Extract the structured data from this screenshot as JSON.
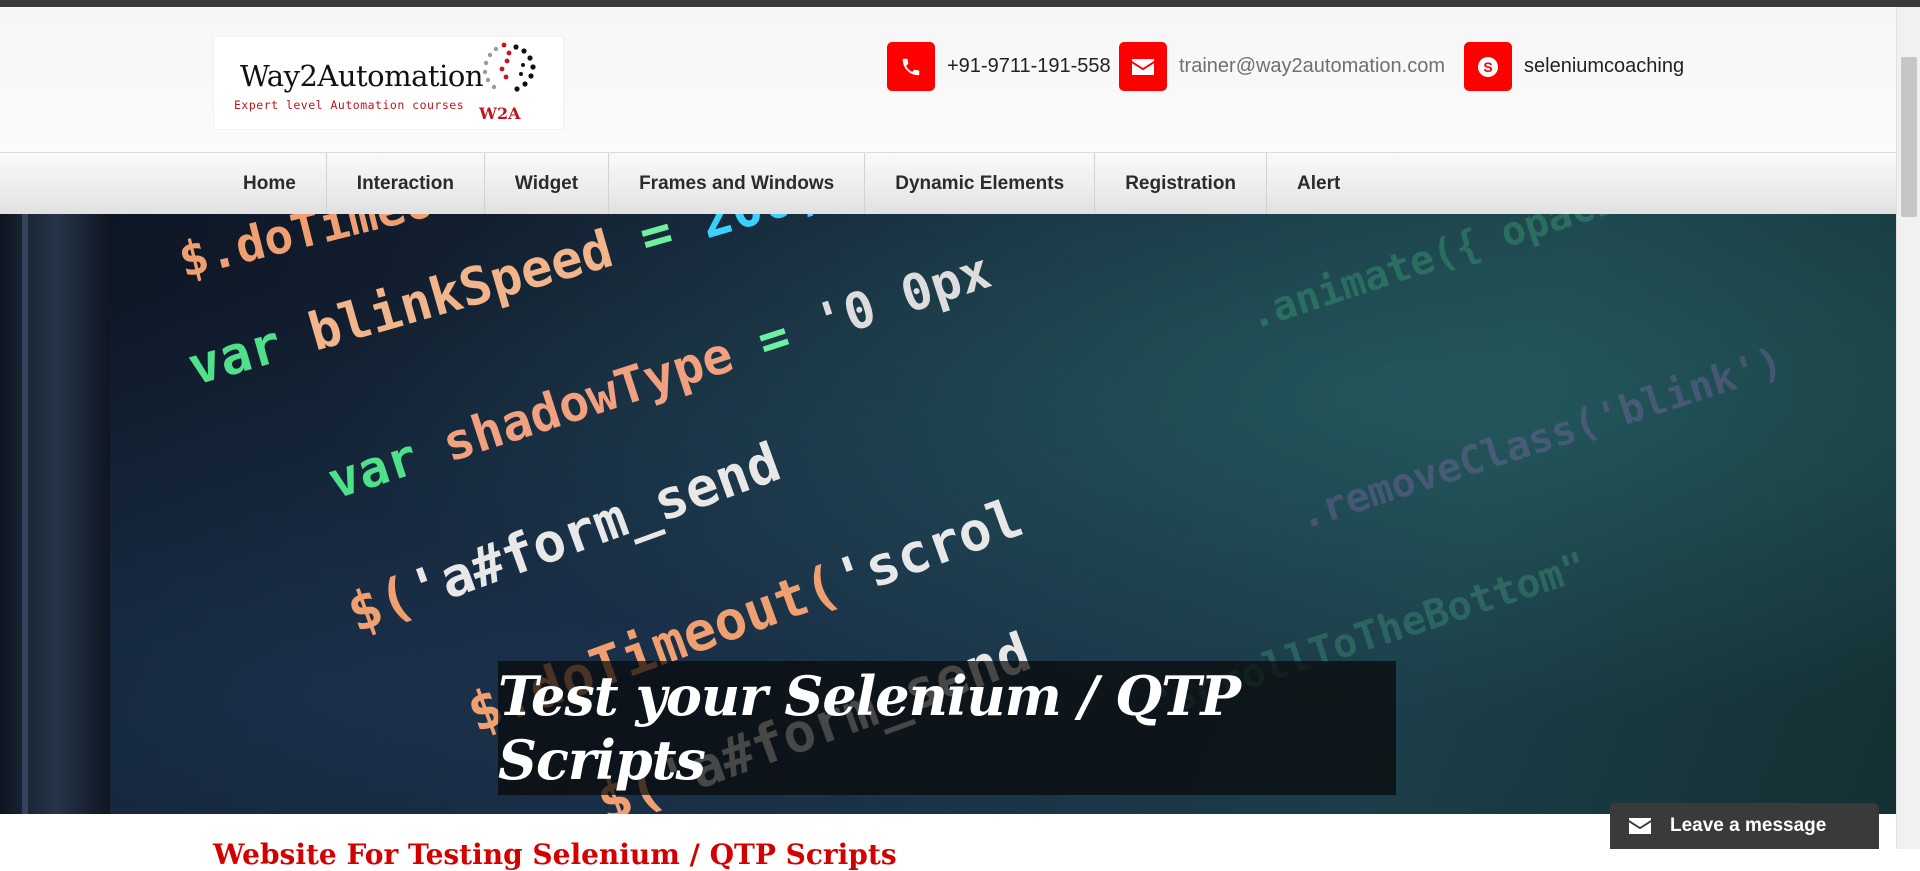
{
  "header": {
    "logo": {
      "brand": "Way2Automation",
      "tagline": "Expert level Automation courses",
      "badge": "W2A"
    },
    "contacts": [
      {
        "icon": "phone-icon",
        "text": "+91-9711-191-558"
      },
      {
        "icon": "envelope-icon",
        "text": "trainer@way2automation.com"
      },
      {
        "icon": "skype-icon",
        "text": "seleniumcoaching"
      }
    ]
  },
  "nav": {
    "items": [
      "Home",
      "Interaction",
      "Widget",
      "Frames and Windows",
      "Dynamic Elements",
      "Registration",
      "Alert"
    ]
  },
  "hero": {
    "caption": "Test your Selenium / QTP Scripts"
  },
  "content": {
    "heading_partial": "Website For Testing Selenium / QTP Scripts"
  },
  "chat": {
    "label": "Leave a message"
  },
  "colors": {
    "accent_red": "#ff0000",
    "brand_red": "#c0141b",
    "nav_text": "#2b2b2b",
    "chat_bg": "#3a3a3a"
  }
}
